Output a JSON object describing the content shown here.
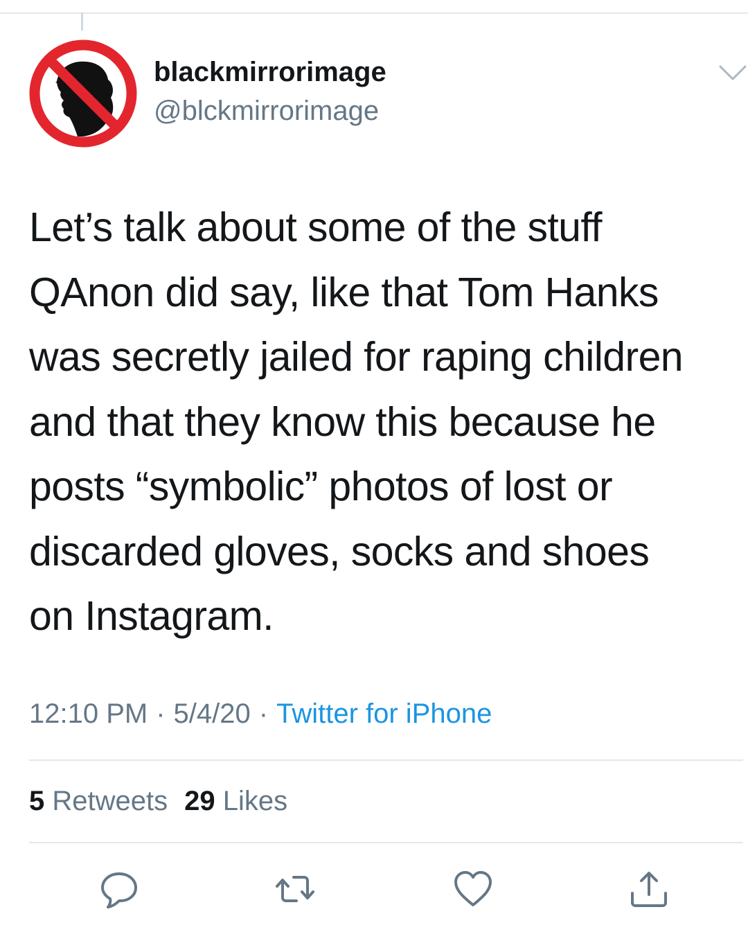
{
  "tweet": {
    "author": {
      "display_name": "blackmirrorimage",
      "handle": "@blckmirrorimage"
    },
    "text_lines": [
      "Let’s talk about some of the stuff",
      "QAnon did say, like that Tom Hanks",
      "was secretly jailed for raping children",
      "and that they know this because he",
      "posts “symbolic” photos of lost or",
      "discarded gloves, socks and shoes",
      "on Instagram."
    ],
    "time": "12:10 PM",
    "separator": "·",
    "date": "5/4/20",
    "source": "Twitter for iPhone",
    "retweets": {
      "count": "5",
      "label": "Retweets"
    },
    "likes": {
      "count": "29",
      "label": "Likes"
    }
  },
  "icons": {
    "avatar": "prohibition-sign-over-silhouette",
    "caret": "chevron-down-icon",
    "reply": "reply-bubble-icon",
    "retweet": "retweet-icon",
    "like": "heart-icon",
    "share": "share-upload-icon"
  },
  "colors": {
    "text_primary": "#14171a",
    "text_secondary": "#657786",
    "link": "#1b95e0",
    "divider": "#e1e8ed",
    "prohibition_red": "#e3262e"
  }
}
